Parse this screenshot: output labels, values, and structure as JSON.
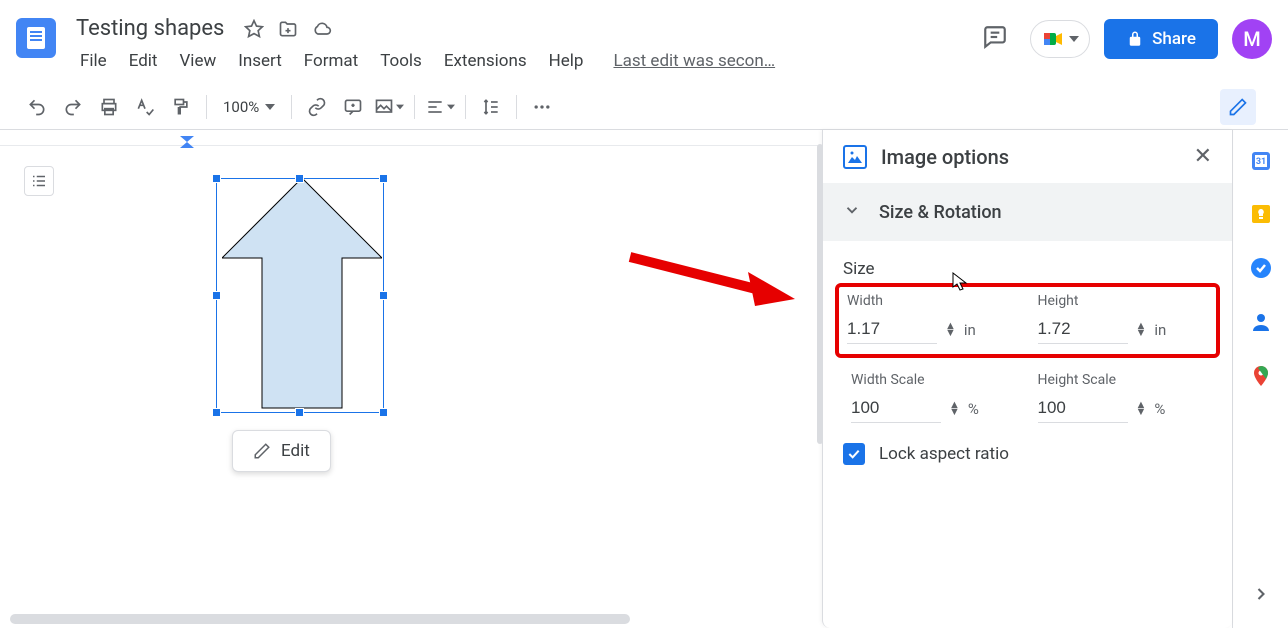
{
  "doc": {
    "title": "Testing shapes"
  },
  "menu": {
    "file": "File",
    "edit": "Edit",
    "view": "View",
    "insert": "Insert",
    "format": "Format",
    "tools": "Tools",
    "extensions": "Extensions",
    "help": "Help",
    "last_edit": "Last edit was secon…"
  },
  "header": {
    "share": "Share",
    "avatar_letter": "M"
  },
  "toolbar": {
    "zoom": "100%"
  },
  "popup": {
    "edit": "Edit"
  },
  "panel": {
    "title": "Image options",
    "section": "Size & Rotation",
    "size_head": "Size",
    "width_label": "Width",
    "width_value": "1.17",
    "width_unit": "in",
    "height_label": "Height",
    "height_value": "1.72",
    "height_unit": "in",
    "ws_label": "Width Scale",
    "ws_value": "100",
    "ws_unit": "%",
    "hs_label": "Height Scale",
    "hs_value": "100",
    "hs_unit": "%",
    "lock": "Lock aspect ratio"
  }
}
